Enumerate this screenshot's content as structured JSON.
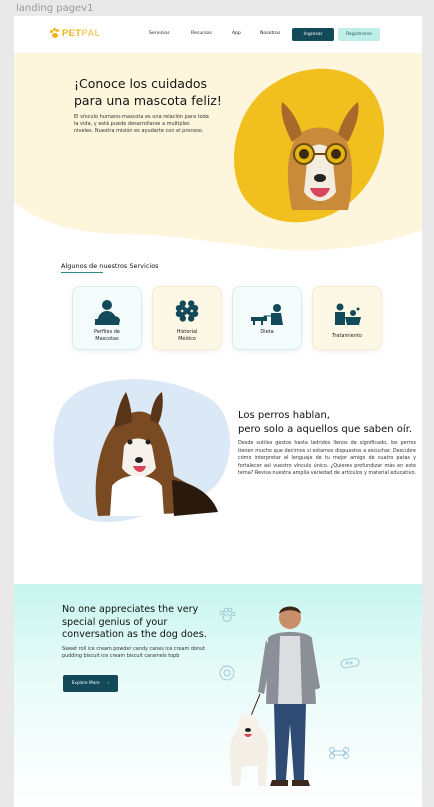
{
  "frame_label": "landing pagev1",
  "nav": {
    "logo_pet": "PET",
    "logo_pal": "PAL",
    "links": [
      "Servicios",
      "Recursos",
      "App",
      "Nosotros"
    ],
    "login_label": "Ingresar",
    "register_label": "Registrarse"
  },
  "hero": {
    "title_line1": "¡Conoce los cuidados",
    "title_line2": "para una mascota feliz!",
    "text": "El vínculo humano-mascota es una relación para toda la vida, y está puede desarrollarse a multiples niveles. Nuestra misión es ayudarte con el proceso."
  },
  "services": {
    "title": "Algunos de nuestros Servicios",
    "cards": [
      {
        "line1": "Perfiles de",
        "line2": "Mascotas",
        "icon": "vet-person-icon"
      },
      {
        "line1": "Historial",
        "line2": "Médico",
        "icon": "bone-icon"
      },
      {
        "line1": "Dieta",
        "line2": "",
        "icon": "dog-walk-icon"
      },
      {
        "line1": "Tratamiento",
        "line2": "",
        "icon": "dog-bath-icon"
      }
    ]
  },
  "dogs": {
    "title_line1": "Los perros hablan,",
    "title_line2": "pero solo a aquellos que saben oír.",
    "text": "Desde sutiles gestos hasta ladridos llenos de significado, los perros tienen mucho que decirnos si estamos dispuestos a escuchar. Descubre cómo interpretar el lenguaje de tu mejor amigo de cuatro patas y fortalecer así vuestro vínculo único. ¿Quieres profundizar más en este tema? Revisa nuestra amplia variedad de artículos y material educativo."
  },
  "bottom": {
    "title": "No one appreciates the very special genius of your conversation as the dog does.",
    "text": "Sweet roll ice cream powder candy canes ice cream donut pudding biscuit ice cream biscuit caramels topb",
    "button_label": "Explore More",
    "button_arrow": "›"
  },
  "colors": {
    "brand_yellow": "#f2c01e",
    "hero_cream": "#fdf6dc",
    "dark_teal": "#134a5a",
    "mint": "#c7f5ee",
    "blue_blob": "#dbe8f6"
  }
}
